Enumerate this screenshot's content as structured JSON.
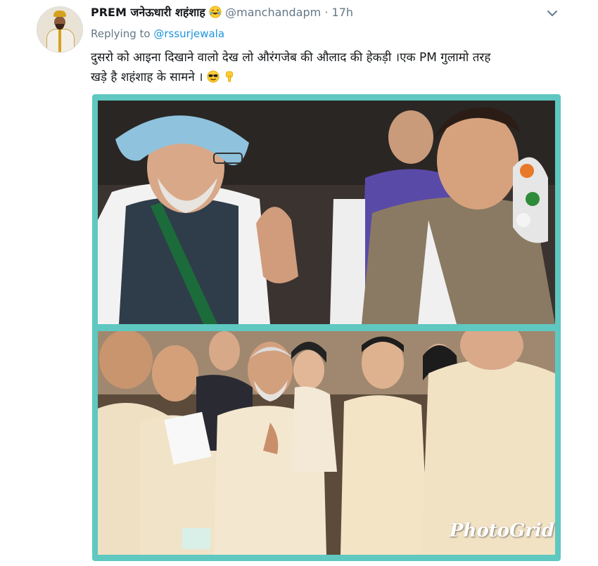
{
  "tweet": {
    "display_name": "PREM जनेऊधारी शहंशाह",
    "handle": "@manchandapm",
    "separator": "·",
    "time": "17h",
    "replying_prefix": "Replying to",
    "replying_handle": "@rssurjewala",
    "text_line1": "दुसरो को आइना दिखाने वालो देख लो औरंगजेब की औलाद की हेकड़ी ।एक PM गुलामो तरह",
    "text_line2": "खड़े है शहंशाह के सामने ।",
    "emojis": [
      "laughing-emoji",
      "sunglasses-emoji",
      "pointing-down-emoji"
    ]
  },
  "media": {
    "watermark": "PhotoGrid",
    "frame_color": "#5fc8c0"
  },
  "colors": {
    "link": "#1b95e0",
    "secondary": "#657786",
    "text": "#14171a"
  }
}
